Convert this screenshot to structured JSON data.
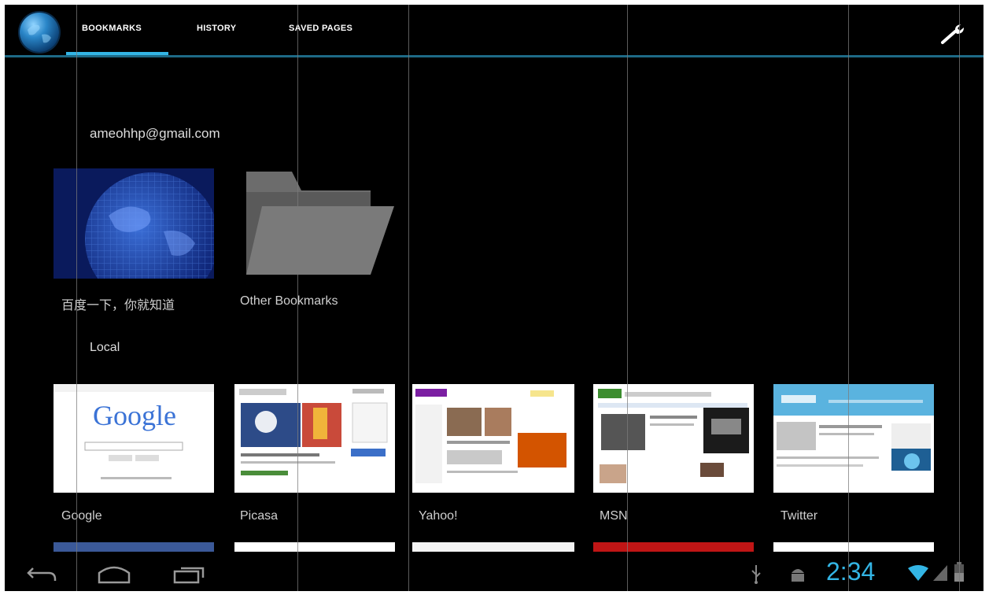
{
  "tabs": [
    {
      "label": "BOOKMARKS"
    },
    {
      "label": "HISTORY"
    },
    {
      "label": "SAVED PAGES"
    }
  ],
  "account": "ameohhp@gmail.com",
  "account_bookmarks": [
    {
      "label": "百度一下，你就知道"
    },
    {
      "label": "Other Bookmarks"
    }
  ],
  "local_section": "Local",
  "local_bookmarks": [
    {
      "label": "Google"
    },
    {
      "label": "Picasa"
    },
    {
      "label": "Yahoo!"
    },
    {
      "label": "MSN"
    },
    {
      "label": "Twitter"
    }
  ],
  "status": {
    "time": "2:34"
  },
  "thumb_text": {
    "google": "Google"
  },
  "colors": {
    "accent": "#33b5e5",
    "topbar_line": "#1e6a86"
  },
  "icons": [
    "globe-icon",
    "wrench-icon",
    "back-icon",
    "home-icon",
    "recent-apps-icon",
    "usb-icon",
    "android-debug-icon",
    "wifi-icon",
    "signal-icon",
    "battery-icon"
  ]
}
